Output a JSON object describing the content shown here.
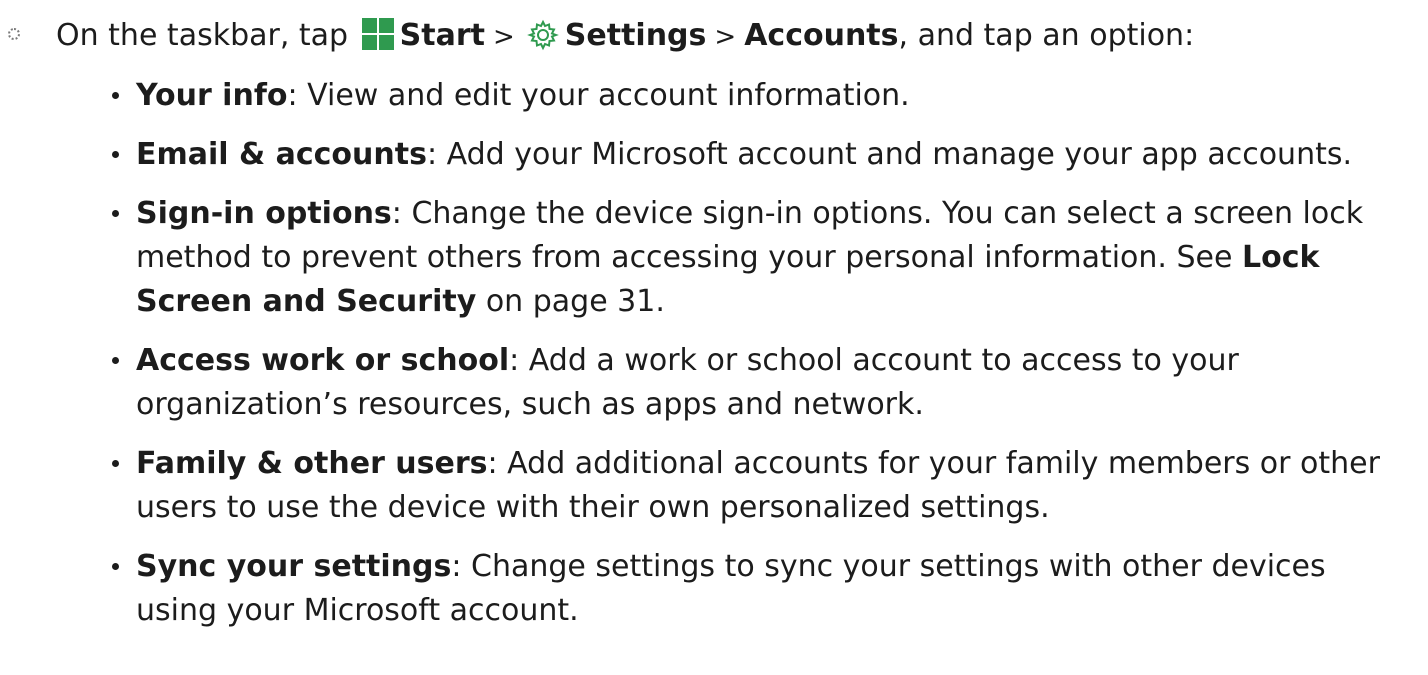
{
  "step": {
    "prefix": "On the taskbar, tap",
    "start_label": "Start",
    "separator_1": ">",
    "settings_label": "Settings",
    "separator_2": ">",
    "accounts_label": "Accounts",
    "suffix": ", and tap an option:",
    "start_icon": "windows-start-icon",
    "settings_icon": "gear-icon",
    "icon_color": "#2f9a4f"
  },
  "options": [
    {
      "term": "Your info",
      "desc": ": View and edit your account information."
    },
    {
      "term": "Email & accounts",
      "desc": ": Add your Microsoft account and manage your app accounts."
    },
    {
      "term": "Sign-in options",
      "desc": ": Change the device sign-in options. You can select a screen lock method to prevent others from accessing your personal information. See ",
      "link": "Lock Screen and Security",
      "desc_end": " on page 31."
    },
    {
      "term": "Access work or school",
      "desc": ": Add a work or school account to access to your organization’s resources, such as apps and network."
    },
    {
      "term": "Family & other users",
      "desc": ": Add additional accounts for your family members or other users to use the device with their own personalized settings."
    },
    {
      "term": "Sync your settings",
      "desc": ": Change settings to sync your settings with other devices using your Microsoft account."
    }
  ]
}
